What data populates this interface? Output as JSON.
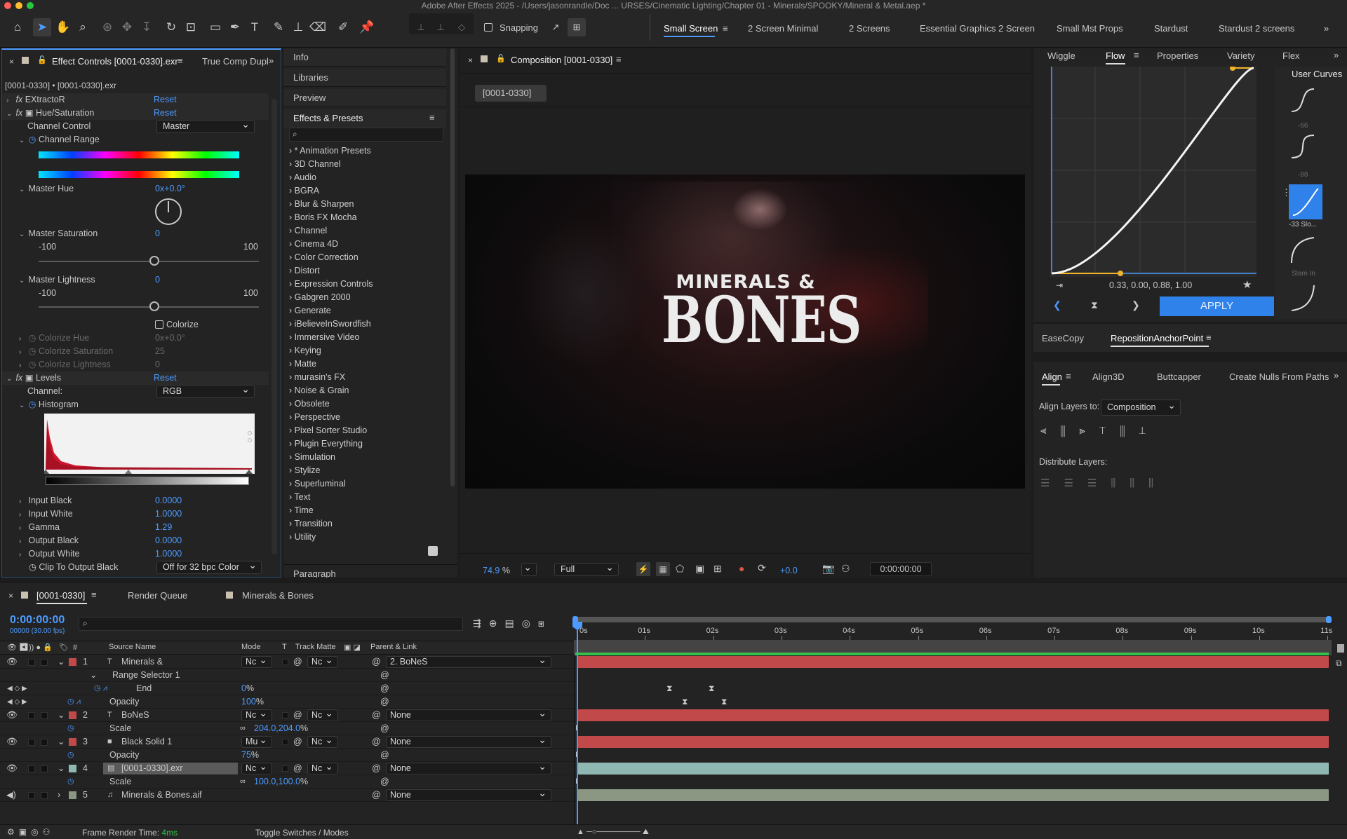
{
  "window": {
    "title": "Adobe After Effects 2025 - /Users/jasonrandle/Doc ... URSES/Cinematic Lighting/Chapter 01 - Minerals/SPOOKY/Mineral & Metal.aep *"
  },
  "toolbar": {
    "snapping_label": "Snapping"
  },
  "workspaces": [
    "Small Screen",
    "2 Screen Minimal",
    "2 Screens",
    "Essential Graphics 2 Screen",
    "Small Mst Props",
    "Stardust",
    "Stardust 2 screens"
  ],
  "effect_controls": {
    "tab_label": "Effect Controls [0001-0330].exr",
    "tab2_label": "True Comp Dupl",
    "layer_path": "[0001-0330] • [0001-0330].exr",
    "reset": "Reset",
    "effects": {
      "extractor": "EXtractoR",
      "hue_sat": "Hue/Saturation",
      "levels": "Levels"
    },
    "hue_sat": {
      "channel_control_label": "Channel Control",
      "channel_control_value": "Master",
      "channel_range_label": "Channel Range",
      "master_hue_label": "Master Hue",
      "master_hue_value": "0x+0.0°",
      "master_sat_label": "Master Saturation",
      "master_sat_value": "0",
      "sat_min": "-100",
      "sat_max": "100",
      "master_light_label": "Master Lightness",
      "master_light_value": "0",
      "light_min": "-100",
      "light_max": "100",
      "colorize_label": "Colorize",
      "colorize_hue_label": "Colorize Hue",
      "colorize_hue_value": "0x+0.0°",
      "colorize_sat_label": "Colorize Saturation",
      "colorize_sat_value": "25",
      "colorize_light_label": "Colorize Lightness",
      "colorize_light_value": "0"
    },
    "levels": {
      "channel_label": "Channel:",
      "channel_value": "RGB",
      "histogram_label": "Histogram",
      "input_black_label": "Input Black",
      "input_black_value": "0.0000",
      "input_white_label": "Input White",
      "input_white_value": "1.0000",
      "gamma_label": "Gamma",
      "gamma_value": "1.29",
      "output_black_label": "Output Black",
      "output_black_value": "0.0000",
      "output_white_label": "Output White",
      "output_white_value": "1.0000",
      "clip_black_label": "Clip To Output Black",
      "clip_black_value": "Off for 32 bpc Color"
    }
  },
  "side_panels": {
    "info": "Info",
    "libraries": "Libraries",
    "preview": "Preview",
    "effects_presets": "Effects & Presets",
    "paragraph": "Paragraph"
  },
  "effects_list": [
    "* Animation Presets",
    "3D Channel",
    "Audio",
    "BGRA",
    "Blur & Sharpen",
    "Boris FX Mocha",
    "Channel",
    "Cinema 4D",
    "Color Correction",
    "Distort",
    "Expression Controls",
    "Gabgren 2000",
    "Generate",
    "iBelieveInSwordfish",
    "Immersive Video",
    "Keying",
    "Matte",
    "murasin's FX",
    "Noise & Grain",
    "Obsolete",
    "Perspective",
    "Pixel Sorter Studio",
    "Plugin Everything",
    "Simulation",
    "Stylize",
    "Superluminal",
    "Text",
    "Time",
    "Transition",
    "Utility"
  ],
  "composition": {
    "tab_label": "Composition [0001-0330]",
    "comp_chip": "[0001-0330]",
    "title_line1": "MINERALS &",
    "title_line2": "BONES",
    "zoom": "74.9",
    "zoom_unit": "%",
    "resolution": "Full",
    "exposure": "+0.0",
    "timecode": "0:00:00:00"
  },
  "flow": {
    "tabs": [
      "Wiggle",
      "Flow",
      "Properties",
      "Variety",
      "Flex"
    ],
    "user_curves_label": "User Curves",
    "preset_labels": [
      "-66",
      "-88",
      "-33 Slo...",
      "Slam In"
    ],
    "bezier_value": "0.33, 0.00, 0.88, 1.00",
    "apply_label": "APPLY"
  },
  "misc_panels": {
    "easecopy": "EaseCopy",
    "reposition": "RepositionAnchorPoint"
  },
  "align": {
    "tabs": [
      "Align",
      "Align3D",
      "Buttcapper",
      "Create Nulls From Paths"
    ],
    "align_to_label": "Align Layers to:",
    "align_to_value": "Composition",
    "distribute_label": "Distribute Layers:"
  },
  "timeline": {
    "comp_tab": "[0001-0330]",
    "render_queue": "Render Queue",
    "minerals_tab": "Minerals & Bones",
    "timecode": "0:00:00:00",
    "frames": "00000 (30.00 fps)",
    "headers": {
      "source": "Source Name",
      "mode": "Mode",
      "t": "T",
      "track_matte": "Track Matte",
      "parent": "Parent & Link"
    },
    "ruler": [
      "0s",
      "01s",
      "02s",
      "03s",
      "04s",
      "05s",
      "06s",
      "07s",
      "08s",
      "09s",
      "10s",
      "11s"
    ],
    "layers": [
      {
        "num": "1",
        "name": "Minerals &",
        "mode": "Nc",
        "matte": "Nc",
        "parent": "2. BoNeS",
        "color": "#c2494a"
      },
      {
        "num": "2",
        "name": "BoNeS",
        "mode": "Nc",
        "matte": "Nc",
        "parent": "None",
        "color": "#c2494a"
      },
      {
        "num": "3",
        "name": "Black Solid 1",
        "mode": "Mu",
        "matte": "Nc",
        "parent": "None",
        "color": "#c2494a"
      },
      {
        "num": "4",
        "name": "[0001-0330].exr",
        "mode": "Nc",
        "matte": "Nc",
        "parent": "None",
        "color": "#8fb8b3"
      },
      {
        "num": "5",
        "name": "Minerals & Bones.aif",
        "mode": "",
        "matte": "",
        "parent": "None",
        "color": "#8b9683"
      }
    ],
    "props": {
      "range_selector": "Range Selector 1",
      "end_label": "End",
      "end_value": "0",
      "end_unit": "%",
      "opacity_label": "Opacity",
      "opacity_value": "100",
      "opacity_unit": "%",
      "scale_label": "Scale",
      "scale2_value": "204.0,204.0",
      "scale_unit": "%",
      "opacity3_value": "75",
      "opacity3_unit": "%",
      "scale4_value": "100.0,100.0"
    },
    "footer": {
      "render_time_label": "Frame Render Time:",
      "render_time_value": "4ms",
      "toggle_label": "Toggle Switches / Modes"
    }
  }
}
